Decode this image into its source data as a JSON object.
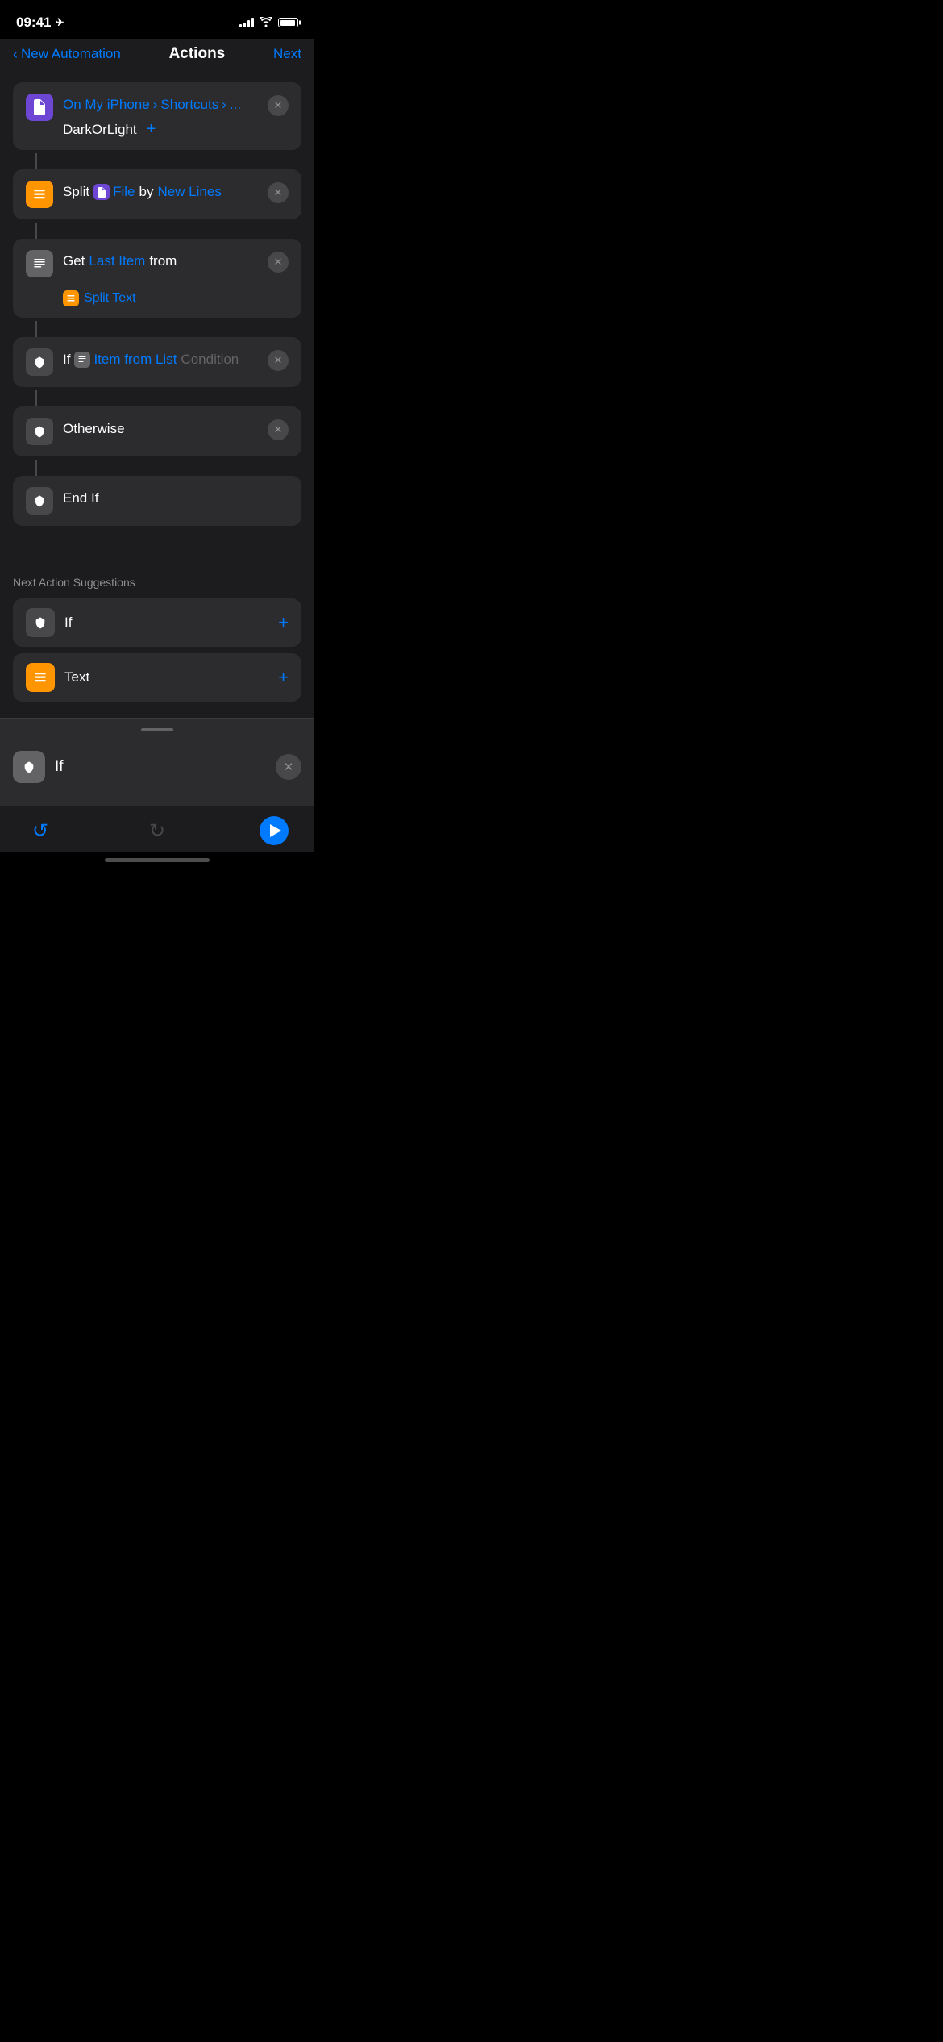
{
  "statusBar": {
    "time": "09:41",
    "locationArrow": "◂",
    "batteryLevel": 90
  },
  "navBar": {
    "backLabel": "New Automation",
    "title": "Actions",
    "nextLabel": "Next"
  },
  "actions": [
    {
      "id": "file-path",
      "iconType": "purple",
      "content": "On My iPhone > Shortcuts > DarkOrLight +",
      "showClose": true
    },
    {
      "id": "split",
      "iconType": "orange",
      "label": "Split",
      "param1": "File",
      "param1Type": "purple-inline",
      "label2": "by",
      "param2": "New Lines",
      "param2Type": "blue",
      "showClose": true
    },
    {
      "id": "get-item",
      "iconType": "gray",
      "label": "Get",
      "param1": "Last Item",
      "param1Type": "blue",
      "label2": "from",
      "param2": "Split Text",
      "param2Type": "orange-inline-blue",
      "showClose": true
    },
    {
      "id": "if-condition",
      "iconType": "gray-dark",
      "label": "If",
      "param1": "Item from List",
      "param1Type": "gray-inline-blue",
      "param2": "Condition",
      "param2Type": "placeholder",
      "showClose": true
    },
    {
      "id": "otherwise",
      "iconType": "gray-dark",
      "label": "Otherwise",
      "showClose": true
    },
    {
      "id": "end-if",
      "iconType": "gray-dark",
      "label": "End If",
      "showClose": false
    }
  ],
  "suggestions": {
    "title": "Next Action Suggestions",
    "items": [
      {
        "id": "if-suggestion",
        "iconType": "gray-dark",
        "label": "If"
      },
      {
        "id": "text-suggestion",
        "iconType": "orange",
        "label": "Text"
      }
    ]
  },
  "bottomSheet": {
    "label": "If"
  },
  "toolbar": {
    "undoLabel": "↺",
    "redoLabel": "↻"
  }
}
